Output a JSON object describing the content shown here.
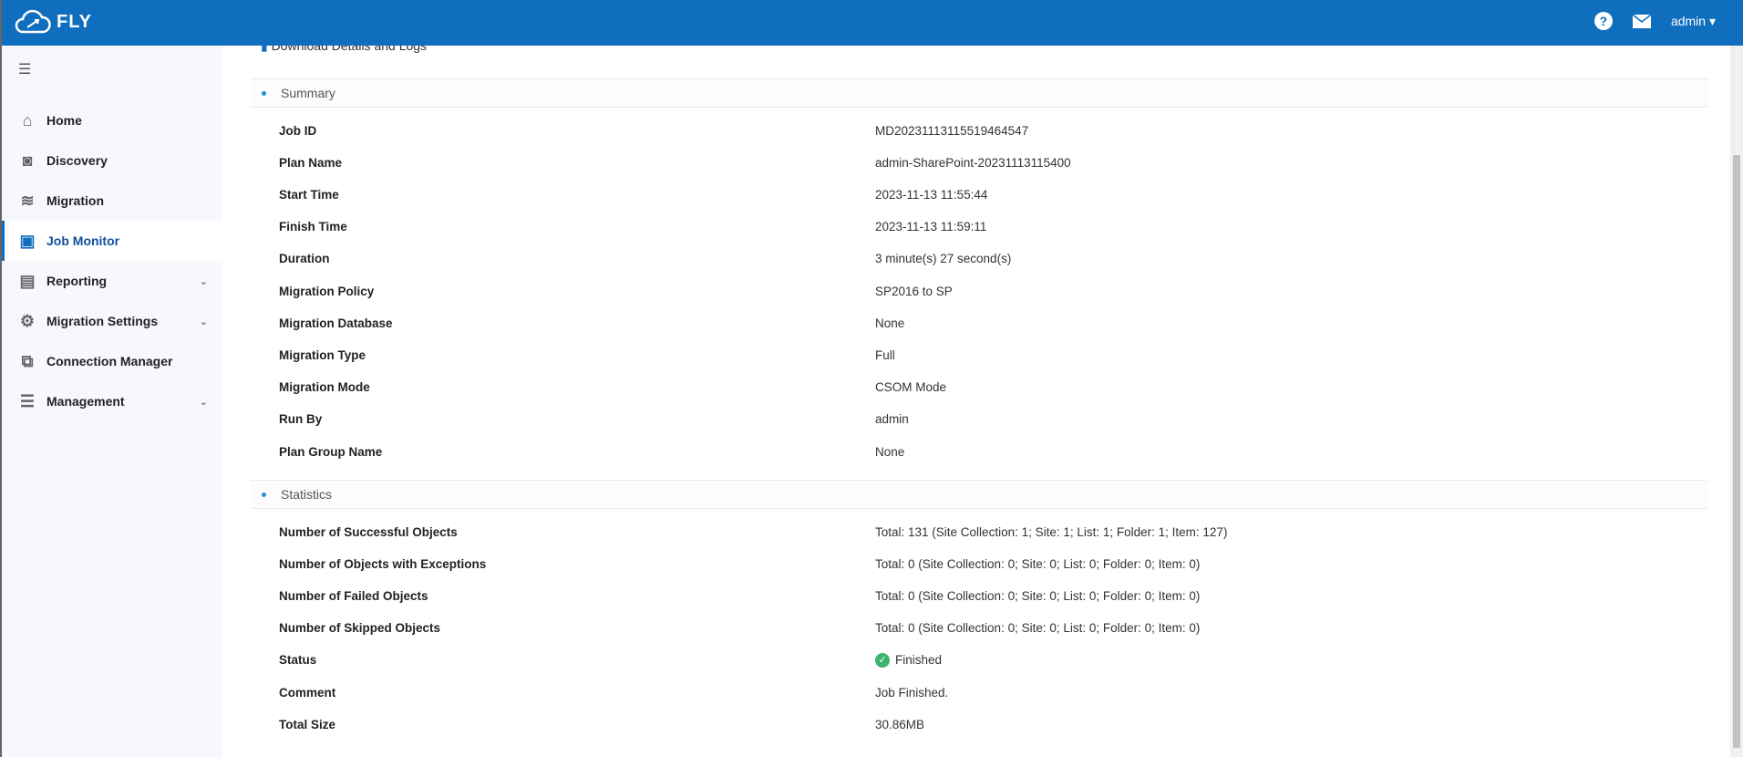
{
  "header": {
    "brand": "FLY",
    "user": "admin",
    "help_icon": "question-circle-icon",
    "mail_icon": "envelope-icon"
  },
  "sidebar": {
    "items": [
      {
        "label": "Home",
        "icon": "home-icon",
        "expandable": false,
        "active": false
      },
      {
        "label": "Discovery",
        "icon": "discovery-icon",
        "expandable": false,
        "active": false
      },
      {
        "label": "Migration",
        "icon": "migration-icon",
        "expandable": false,
        "active": false
      },
      {
        "label": "Job Monitor",
        "icon": "monitor-icon",
        "expandable": false,
        "active": true
      },
      {
        "label": "Reporting",
        "icon": "report-icon",
        "expandable": true,
        "active": false
      },
      {
        "label": "Migration Settings",
        "icon": "settings-icon",
        "expandable": true,
        "active": false
      },
      {
        "label": "Connection Manager",
        "icon": "connection-icon",
        "expandable": false,
        "active": false
      },
      {
        "label": "Management",
        "icon": "sliders-icon",
        "expandable": true,
        "active": false
      }
    ]
  },
  "main": {
    "top_link": "Download Details and Logs",
    "summary": {
      "title": "Summary",
      "rows": [
        {
          "label": "Job ID",
          "value": "MD20231113115519464547"
        },
        {
          "label": "Plan Name",
          "value": "admin-SharePoint-20231113115400"
        },
        {
          "label": "Start Time",
          "value": "2023-11-13 11:55:44"
        },
        {
          "label": "Finish Time",
          "value": "2023-11-13 11:59:11"
        },
        {
          "label": "Duration",
          "value": "3 minute(s) 27 second(s)"
        },
        {
          "label": "Migration Policy",
          "value": "SP2016 to SP"
        },
        {
          "label": "Migration Database",
          "value": "None"
        },
        {
          "label": "Migration Type",
          "value": "Full"
        },
        {
          "label": "Migration Mode",
          "value": "CSOM Mode"
        },
        {
          "label": "Run By",
          "value": "admin"
        },
        {
          "label": "Plan Group Name",
          "value": "None"
        }
      ]
    },
    "statistics": {
      "title": "Statistics",
      "rows": [
        {
          "label": "Number of Successful Objects",
          "value": "Total: 131 (Site Collection: 1; Site: 1; List: 1; Folder: 1; Item: 127)"
        },
        {
          "label": "Number of Objects with Exceptions",
          "value": "Total: 0 (Site Collection: 0; Site: 0; List: 0; Folder: 0; Item: 0)"
        },
        {
          "label": "Number of Failed Objects",
          "value": "Total: 0 (Site Collection: 0; Site: 0; List: 0; Folder: 0; Item: 0)"
        },
        {
          "label": "Number of Skipped Objects",
          "value": "Total: 0 (Site Collection: 0; Site: 0; List: 0; Folder: 0; Item: 0)"
        },
        {
          "label": "Status",
          "value": "Finished",
          "icon": "check-circle-icon",
          "color": "#3cb371"
        },
        {
          "label": "Comment",
          "value": "Job Finished."
        },
        {
          "label": "Total Size",
          "value": "30.86MB"
        }
      ]
    }
  },
  "colors": {
    "brand": "#106ebe",
    "active_text": "#0e4f9a",
    "sidebar_bg": "#f7f8fd"
  }
}
